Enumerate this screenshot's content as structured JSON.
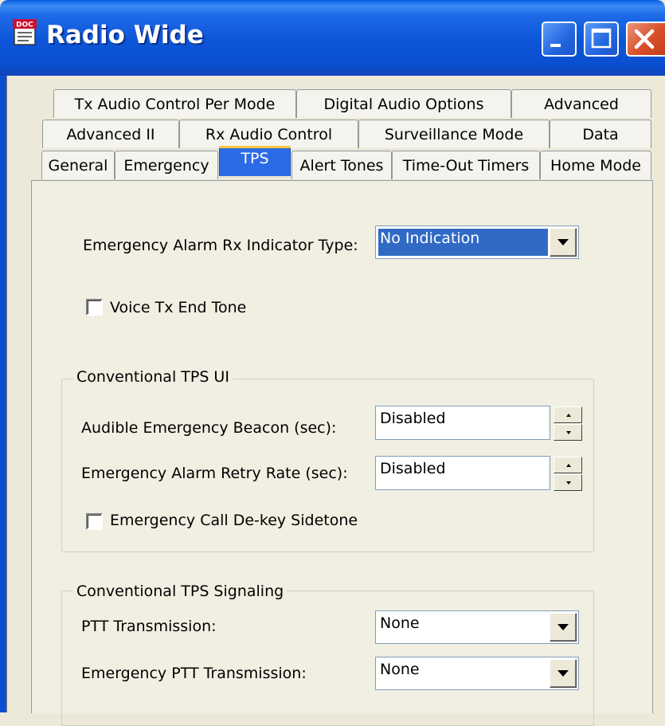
{
  "window": {
    "title": "Radio Wide",
    "app_icon": "doc-icon",
    "app_icon_text": "DOC",
    "controls": [
      "minimize-icon",
      "maximize-icon",
      "close-icon"
    ]
  },
  "tabs": {
    "row1": [
      "Tx Audio Control Per Mode",
      "Digital Audio Options",
      "Advanced"
    ],
    "row2": [
      "Advanced II",
      "Rx Audio Control",
      "Surveillance Mode",
      "Data"
    ],
    "row3": [
      "General",
      "Emergency",
      "TPS",
      "Alert Tones",
      "Time-Out Timers",
      "Home Mode"
    ],
    "active": "TPS"
  },
  "panel": {
    "indicator": {
      "label": "Emergency Alarm Rx Indicator Type:",
      "value": "No Indication"
    },
    "voice_tx_end_tone": {
      "label": "Voice Tx End Tone",
      "checked": false
    },
    "conventional_ui": {
      "title": "Conventional TPS UI",
      "beacon": {
        "label": "Audible Emergency Beacon (sec):",
        "value": "Disabled"
      },
      "retry": {
        "label": "Emergency Alarm Retry Rate (sec):",
        "value": "Disabled"
      },
      "dekey": {
        "label": "Emergency Call De-key Sidetone",
        "checked": false
      }
    },
    "conventional_signaling": {
      "title": "Conventional TPS Signaling",
      "ptt": {
        "label": "PTT Transmission:",
        "value": "None"
      },
      "emergency_ptt": {
        "label": "Emergency PTT Transmission:",
        "value": "None"
      }
    }
  },
  "colors": {
    "titlebar": "#0A4FD0",
    "active_tab": "#2C6BE6",
    "selection": "#316AC5",
    "close_button": "#D9502A",
    "face": "#ECE9D8"
  }
}
